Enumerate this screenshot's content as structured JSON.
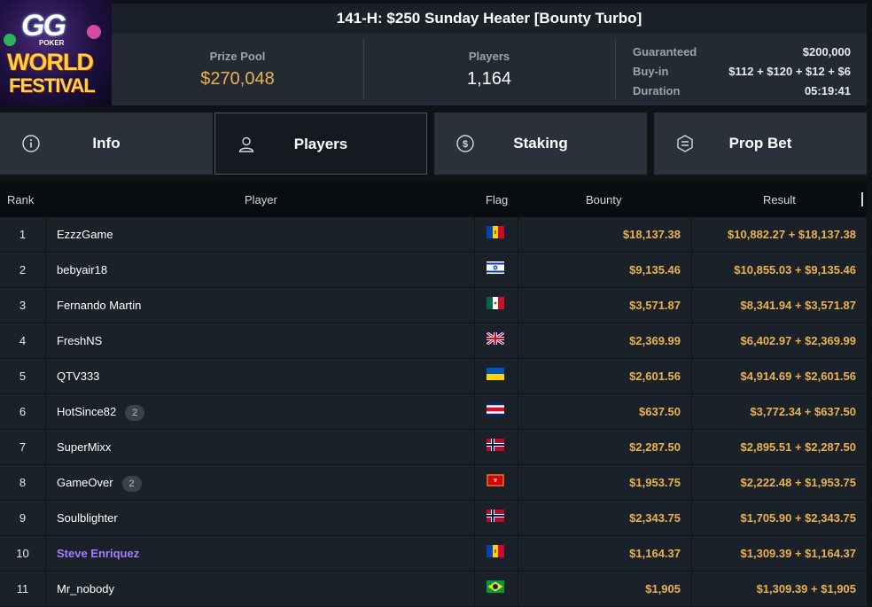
{
  "logo": {
    "brand": "GG",
    "sub": "POKER",
    "line1": "WORLD",
    "line2": "FESTIVAL"
  },
  "header": {
    "title": "141-H: $250 Sunday Heater [Bounty Turbo]",
    "prize_pool_label": "Prize Pool",
    "prize_pool_value": "$270,048",
    "players_label": "Players",
    "players_value": "1,164",
    "details": [
      {
        "label": "Guaranteed",
        "value": "$200,000"
      },
      {
        "label": "Buy-in",
        "value": "$112 + $120 + $12 + $6"
      },
      {
        "label": "Duration",
        "value": "05:19:41"
      }
    ]
  },
  "tabs": [
    {
      "label": "Info",
      "icon": "info-icon"
    },
    {
      "label": "Players",
      "icon": "user-icon",
      "active": true
    },
    {
      "label": "Staking",
      "icon": "coin-dollar-icon"
    },
    {
      "label": "Prop Bet",
      "icon": "prop-bet-icon"
    }
  ],
  "table": {
    "columns": {
      "rank": "Rank",
      "player": "Player",
      "flag": "Flag",
      "bounty": "Bounty",
      "result": "Result"
    },
    "rows": [
      {
        "rank": "1",
        "player": "EzzzGame",
        "badge": "",
        "flag": "Moldova",
        "bounty": "$18,137.38",
        "result": "$10,882.27 + $18,137.38"
      },
      {
        "rank": "2",
        "player": "bebyair18",
        "badge": "",
        "flag": "Israel",
        "bounty": "$9,135.46",
        "result": "$10,855.03 + $9,135.46"
      },
      {
        "rank": "3",
        "player": "Fernando Martin",
        "badge": "",
        "flag": "Mexico",
        "bounty": "$3,571.87",
        "result": "$8,341.94 + $3,571.87"
      },
      {
        "rank": "4",
        "player": "FreshNS",
        "badge": "",
        "flag": "United Kingdom",
        "bounty": "$2,369.99",
        "result": "$6,402.97 + $2,369.99"
      },
      {
        "rank": "5",
        "player": "QTV333",
        "badge": "",
        "flag": "Ukraine",
        "bounty": "$2,601.56",
        "result": "$4,914.69 + $2,601.56"
      },
      {
        "rank": "6",
        "player": "HotSince82",
        "badge": "2",
        "flag": "Costa Rica",
        "bounty": "$637.50",
        "result": "$3,772.34 + $637.50"
      },
      {
        "rank": "7",
        "player": "SuperMixx",
        "badge": "",
        "flag": "Norway",
        "bounty": "$2,287.50",
        "result": "$2,895.51 + $2,287.50"
      },
      {
        "rank": "8",
        "player": "GameOver",
        "badge": "2",
        "flag": "Montenegro",
        "bounty": "$1,953.75",
        "result": "$2,222.48 + $1,953.75"
      },
      {
        "rank": "9",
        "player": "Soulblighter",
        "badge": "",
        "flag": "Norway",
        "bounty": "$2,343.75",
        "result": "$1,705.90 + $2,343.75"
      },
      {
        "rank": "10",
        "player": "Steve Enriquez",
        "badge": "",
        "highlight": true,
        "flag": "Moldova",
        "bounty": "$1,164.37",
        "result": "$1,309.39 + $1,164.37"
      },
      {
        "rank": "11",
        "player": "Mr_nobody",
        "badge": "",
        "flag": "Brazil",
        "bounty": "$1,905",
        "result": "$1,309.39 + $1,905"
      }
    ]
  },
  "colors": {
    "accent_gold": "#e9b24e",
    "highlight_purple": "#a77bff",
    "panel": "#232a33",
    "row": "#1b2128"
  }
}
